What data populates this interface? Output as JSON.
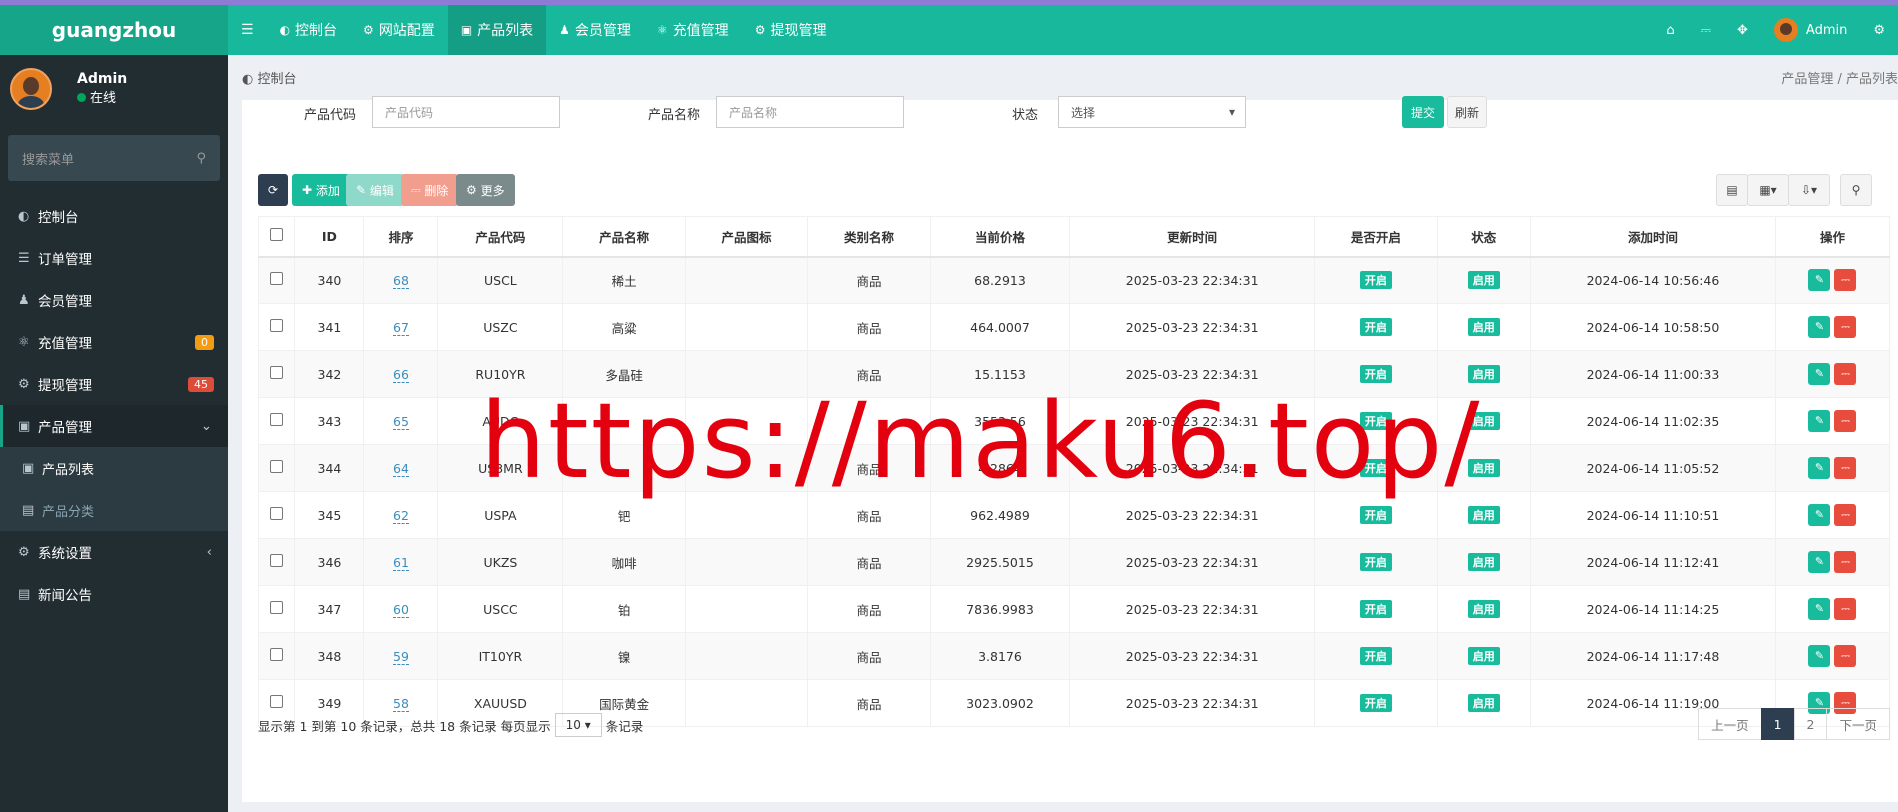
{
  "app": {
    "name": "guangzhou"
  },
  "user": {
    "name": "Admin",
    "status": "在线"
  },
  "sidebar": {
    "search_placeholder": "搜索菜单",
    "items": [
      {
        "label": "控制台",
        "icon": "dashboard-icon"
      },
      {
        "label": "订单管理",
        "icon": "list-icon"
      },
      {
        "label": "会员管理",
        "icon": "users-icon"
      },
      {
        "label": "充值管理",
        "icon": "recharge-icon",
        "badge": "0"
      },
      {
        "label": "提现管理",
        "icon": "withdraw-icon",
        "badge": "45"
      },
      {
        "label": "产品管理",
        "icon": "bag-icon"
      },
      {
        "label": "产品列表",
        "icon": "bag-icon"
      },
      {
        "label": "产品分类",
        "icon": "category-icon"
      },
      {
        "label": "系统设置",
        "icon": "gears-icon"
      },
      {
        "label": "新闻公告",
        "icon": "news-icon"
      }
    ]
  },
  "topnav": {
    "tabs": [
      {
        "label": "控制台",
        "icon": "dashboard-icon"
      },
      {
        "label": "网站配置",
        "icon": "gear-icon"
      },
      {
        "label": "产品列表",
        "icon": "bag-icon"
      },
      {
        "label": "会员管理",
        "icon": "users-icon"
      },
      {
        "label": "充值管理",
        "icon": "recharge-icon"
      },
      {
        "label": "提现管理",
        "icon": "withdraw-icon"
      }
    ],
    "user": "Admin"
  },
  "breadcrumb": {
    "left": "控制台",
    "path1": "产品管理",
    "path2": "产品列表"
  },
  "filter": {
    "code_label": "产品代码",
    "code_placeholder": "产品代码",
    "name_label": "产品名称",
    "name_placeholder": "产品名称",
    "status_label": "状态",
    "status_value": "选择",
    "submit": "提交",
    "reset": "刷新"
  },
  "toolbar": {
    "add": "添加",
    "edit": "编辑",
    "delete": "删除",
    "more": "更多"
  },
  "table": {
    "headers": [
      "ID",
      "排序",
      "产品代码",
      "产品名称",
      "产品图标",
      "类别名称",
      "当前价格",
      "更新时间",
      "是否开启",
      "状态",
      "添加时间",
      "操作"
    ],
    "rows": [
      {
        "id": "340",
        "sort": "68",
        "code": "USCL",
        "name": "稀土",
        "cat": "商品",
        "price": "68.2913",
        "updated": "2025-03-23 22:34:31",
        "open": "开启",
        "status": "启用",
        "added": "2024-06-14 10:56:46"
      },
      {
        "id": "341",
        "sort": "67",
        "code": "USZC",
        "name": "高粱",
        "cat": "商品",
        "price": "464.0007",
        "updated": "2025-03-23 22:34:31",
        "open": "开启",
        "status": "启用",
        "added": "2024-06-14 10:58:50"
      },
      {
        "id": "342",
        "sort": "66",
        "code": "RU10YR",
        "name": "多晶硅",
        "cat": "商品",
        "price": "15.1153",
        "updated": "2025-03-23 22:34:31",
        "open": "开启",
        "status": "启用",
        "added": "2024-06-14 11:00:33"
      },
      {
        "id": "343",
        "sort": "65",
        "code": "AUDC",
        "name": "",
        "cat": "",
        "price": "3553.56",
        "updated": "2025-03-23 22:34:31",
        "open": "开启",
        "status": "启用",
        "added": "2024-06-14 11:02:35"
      },
      {
        "id": "344",
        "sort": "64",
        "code": "US3MR",
        "name": "",
        "cat": "商品",
        "price": "4.2864",
        "updated": "2025-03-23 22:34:31",
        "open": "开启",
        "status": "启用",
        "added": "2024-06-14 11:05:52"
      },
      {
        "id": "345",
        "sort": "62",
        "code": "USPA",
        "name": "钯",
        "cat": "商品",
        "price": "962.4989",
        "updated": "2025-03-23 22:34:31",
        "open": "开启",
        "status": "启用",
        "added": "2024-06-14 11:10:51"
      },
      {
        "id": "346",
        "sort": "61",
        "code": "UKZS",
        "name": "咖啡",
        "cat": "商品",
        "price": "2925.5015",
        "updated": "2025-03-23 22:34:31",
        "open": "开启",
        "status": "启用",
        "added": "2024-06-14 11:12:41"
      },
      {
        "id": "347",
        "sort": "60",
        "code": "USCC",
        "name": "铂",
        "cat": "商品",
        "price": "7836.9983",
        "updated": "2025-03-23 22:34:31",
        "open": "开启",
        "status": "启用",
        "added": "2024-06-14 11:14:25"
      },
      {
        "id": "348",
        "sort": "59",
        "code": "IT10YR",
        "name": "镍",
        "cat": "商品",
        "price": "3.8176",
        "updated": "2025-03-23 22:34:31",
        "open": "开启",
        "status": "启用",
        "added": "2024-06-14 11:17:48"
      },
      {
        "id": "349",
        "sort": "58",
        "code": "XAUUSD",
        "name": "国际黄金",
        "cat": "商品",
        "price": "3023.0902",
        "updated": "2025-03-23 22:34:31",
        "open": "开启",
        "status": "启用",
        "added": "2024-06-14 11:19:00"
      }
    ]
  },
  "footer": {
    "text_before": "显示第 1 到第 10 条记录，总共 18 条记录 每页显示",
    "page_size": "10",
    "text_after": "条记录",
    "prev": "上一页",
    "p1": "1",
    "p2": "2",
    "next": "下一页"
  },
  "watermark": "https://maku6.top/",
  "colors": {
    "brand": "#17b89c",
    "sidebar": "#222d32",
    "danger": "#e74c3c",
    "dark": "#2c3e50"
  }
}
